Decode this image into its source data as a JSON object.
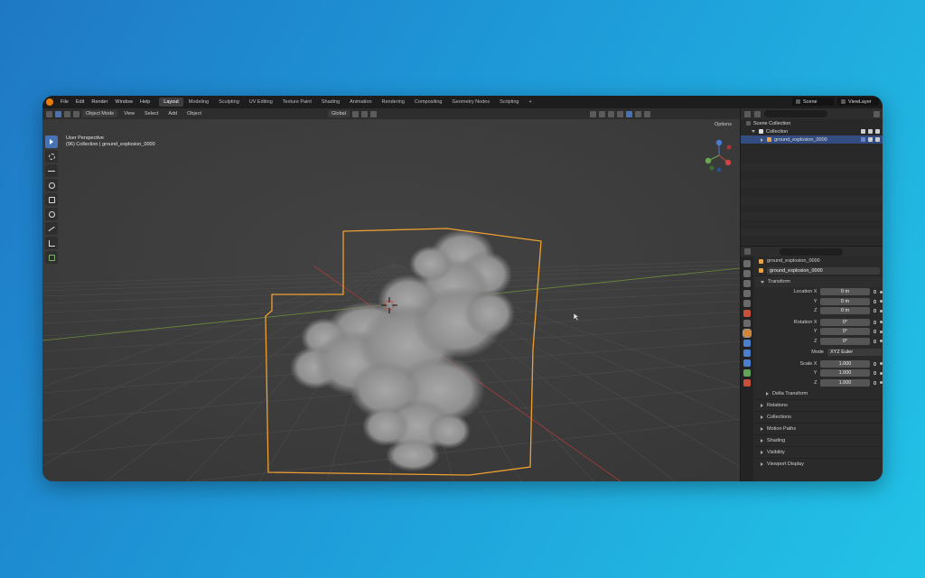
{
  "menubar": {
    "menus": [
      "File",
      "Edit",
      "Render",
      "Window",
      "Help"
    ],
    "workspaces": [
      "Layout",
      "Modeling",
      "Sculpting",
      "UV Editing",
      "Texture Paint",
      "Shading",
      "Animation",
      "Rendering",
      "Compositing",
      "Geometry Nodes",
      "Scripting"
    ],
    "add_tab": "+",
    "scene": "Scene",
    "view_layer": "ViewLayer"
  },
  "viewport_header": {
    "mode": "Object Mode",
    "menus": [
      "View",
      "Select",
      "Add",
      "Object"
    ],
    "orientation": "Global",
    "options": "Options"
  },
  "viewport": {
    "perspective": "User Perspective",
    "info": "(96) Collection | ground_explosion_0000"
  },
  "outliner": {
    "scene_collection": "Scene Collection",
    "collection": "Collection",
    "object": "ground_explosion_0000"
  },
  "properties": {
    "object_name": "ground_explosion_0000",
    "data_name": "ground_explosion_0000",
    "transform_label": "Transform",
    "location": {
      "label": "Location X",
      "x": "0 m",
      "y_label": "Y",
      "y": "0 m",
      "z_label": "Z",
      "z": "0 m"
    },
    "rotation": {
      "label": "Rotation X",
      "x": "0°",
      "y_label": "Y",
      "y": "0°",
      "z_label": "Z",
      "z": "0°"
    },
    "mode": {
      "label": "Mode",
      "value": "XYZ Euler"
    },
    "scale": {
      "label": "Scale X",
      "x": "1.000",
      "y_label": "Y",
      "y": "1.000",
      "z_label": "Z",
      "z": "1.000"
    },
    "delta": "Delta Transform",
    "sections": [
      "Relations",
      "Collections",
      "Motion Paths",
      "Shading",
      "Visibility",
      "Viewport Display"
    ]
  },
  "colors": {
    "accent": "#4772b3",
    "selection_outline": "#f0a030"
  }
}
